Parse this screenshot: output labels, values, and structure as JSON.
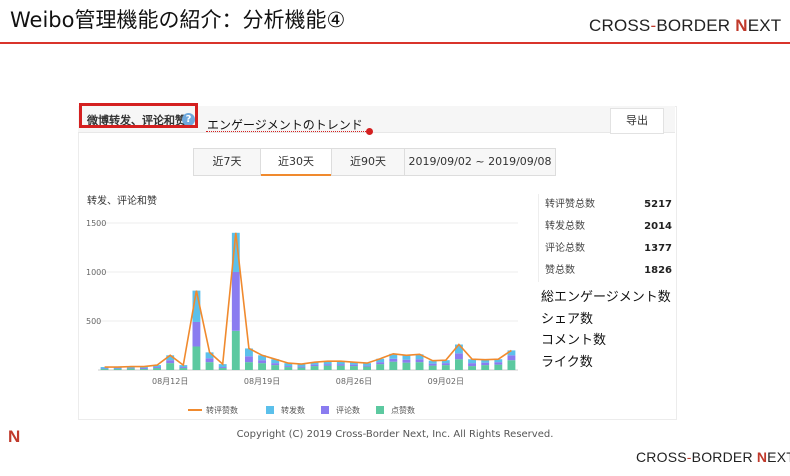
{
  "slide": {
    "title": "Weibo管理機能の紹介：分析機能④",
    "logo": {
      "a": "CROSS",
      "dash": "-",
      "b": "BORDER ",
      "n": "N",
      "c": "EXT"
    },
    "footer_logo_mark": "N",
    "copyright": "Copyright (C) 2019 Cross-Border Next, Inc. All Rights Reserved."
  },
  "panel": {
    "section_title": "微博转发、评论和赞",
    "help_icon": "?",
    "annotation": "エンゲージメントのトレンド",
    "export_label": "导出",
    "tabs": [
      {
        "label": "近7天",
        "active": false
      },
      {
        "label": "近30天",
        "active": true
      },
      {
        "label": "近90天",
        "active": false
      },
      {
        "label": "2019/09/02 ~ 2019/09/08",
        "active": false
      }
    ],
    "chart_title": "转发、评论和赞"
  },
  "stats": [
    {
      "label": "转评赞总数",
      "value": "5217"
    },
    {
      "label": "转发总数",
      "value": "2014"
    },
    {
      "label": "评论总数",
      "value": "1377"
    },
    {
      "label": "赞总数",
      "value": "1826"
    }
  ],
  "jp_legend": [
    "総エンゲージメント数",
    "シェア数",
    "コメント数",
    "ライク数"
  ],
  "colors": {
    "accent": "#d9342b",
    "total": "#f08a2e",
    "repost": "#5bc0eb",
    "comment": "#8a7cf0",
    "like": "#5cc9a0"
  },
  "chart_data": {
    "type": "bar",
    "title": "转发、评论和赞",
    "stacked": true,
    "ylim": [
      0,
      1500
    ],
    "yticks": [
      "500",
      "1000",
      "1500"
    ],
    "xticks": [
      {
        "index": 5,
        "label": "08月12日"
      },
      {
        "index": 12,
        "label": "08月19日"
      },
      {
        "index": 19,
        "label": "08月26日"
      },
      {
        "index": 26,
        "label": "09月02日"
      }
    ],
    "series": [
      {
        "name": "转发数",
        "values": [
          15,
          15,
          15,
          15,
          20,
          50,
          20,
          320,
          60,
          30,
          400,
          80,
          50,
          40,
          30,
          25,
          25,
          30,
          30,
          25,
          25,
          35,
          50,
          45,
          50,
          30,
          30,
          90,
          40,
          30,
          30,
          50
        ]
      },
      {
        "name": "评论数",
        "values": [
          5,
          5,
          5,
          10,
          10,
          30,
          10,
          250,
          40,
          10,
          600,
          60,
          30,
          20,
          10,
          10,
          15,
          15,
          15,
          15,
          10,
          20,
          30,
          30,
          30,
          20,
          20,
          60,
          30,
          25,
          25,
          50
        ]
      },
      {
        "name": "点赞数",
        "values": [
          10,
          10,
          15,
          10,
          20,
          70,
          20,
          240,
          80,
          20,
          400,
          80,
          70,
          50,
          30,
          25,
          40,
          45,
          45,
          40,
          35,
          60,
          85,
          75,
          80,
          45,
          50,
          110,
          40,
          50,
          55,
          100
        ]
      },
      {
        "name": "转评赞数",
        "values": [
          30,
          30,
          35,
          35,
          50,
          150,
          50,
          810,
          180,
          60,
          1400,
          220,
          150,
          110,
          70,
          60,
          80,
          90,
          90,
          80,
          70,
          115,
          165,
          150,
          160,
          95,
          100,
          260,
          110,
          105,
          110,
          200
        ]
      }
    ]
  }
}
